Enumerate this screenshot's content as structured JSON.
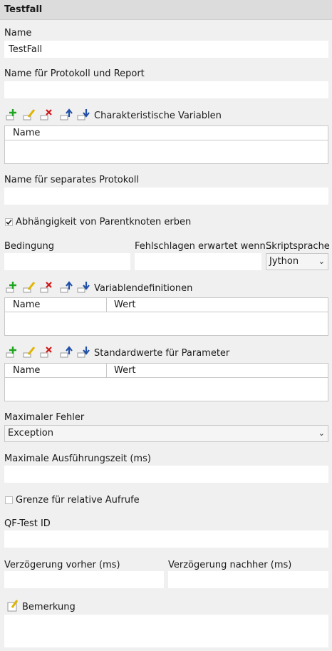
{
  "header": {
    "title": "Testfall"
  },
  "name": {
    "label": "Name",
    "value": "TestFall"
  },
  "report_name": {
    "label": "Name für Protokoll und Report",
    "value": ""
  },
  "char_vars": {
    "label": "Charakteristische Variablen",
    "columns": [
      "Name"
    ]
  },
  "separate_log": {
    "label": "Name für separates Protokoll",
    "value": ""
  },
  "inherit": {
    "label": "Abhängigkeit von Parentknoten erben",
    "checked": true
  },
  "condition": {
    "label": "Bedingung",
    "value": ""
  },
  "expected_fail": {
    "label": "Fehlschlagen erwartet wenn...",
    "value": ""
  },
  "script_lang": {
    "label": "Skriptsprache",
    "value": "Jython"
  },
  "var_defs": {
    "label": "Variablendefinitionen",
    "columns": [
      "Name",
      "Wert"
    ]
  },
  "defaults": {
    "label": "Standardwerte für Parameter",
    "columns": [
      "Name",
      "Wert"
    ]
  },
  "max_error": {
    "label": "Maximaler Fehler",
    "value": "Exception"
  },
  "max_time": {
    "label": "Maximale Ausführungszeit (ms)",
    "value": ""
  },
  "relative_limit": {
    "label": "Grenze für relative Aufrufe",
    "checked": false
  },
  "qf_id": {
    "label": "QF-Test ID",
    "value": ""
  },
  "delay_before": {
    "label": "Verzögerung vorher (ms)",
    "value": ""
  },
  "delay_after": {
    "label": "Verzögerung nachher (ms)",
    "value": ""
  },
  "comment": {
    "label": "Bemerkung",
    "value": ""
  },
  "icons": [
    "add-icon",
    "edit-icon",
    "delete-icon",
    "move-up-icon",
    "move-down-icon"
  ],
  "colors": {
    "add": "#1fa51f",
    "edit": "#e0b400",
    "delete": "#d01818",
    "move": "#1f4fa8"
  }
}
